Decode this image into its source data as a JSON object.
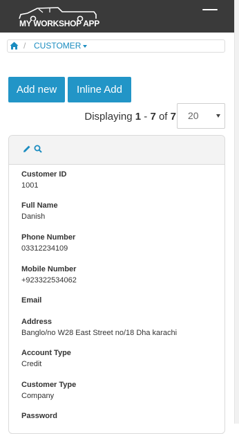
{
  "header": {
    "app_name": "MY WORKSHOP APP",
    "logo_icon": "pickup-truck-icon",
    "menu_icon": "hamburger-menu-icon"
  },
  "breadcrumb": {
    "home_icon": "home-icon",
    "separator": "/",
    "current": "CUSTOMER"
  },
  "toolbar": {
    "add_new_label": "Add new",
    "inline_add_label": "Inline Add"
  },
  "pagination": {
    "prefix": "Displaying",
    "from": "1",
    "dash": "-",
    "to": "7",
    "of": "of",
    "total": "7",
    "page_size": "20"
  },
  "record": {
    "fields": [
      {
        "label": "Customer ID",
        "value": "1001"
      },
      {
        "label": "Full Name",
        "value": "Danish"
      },
      {
        "label": "Phone Number",
        "value": "03312234109"
      },
      {
        "label": "Mobile Number",
        "value": "+923322534062"
      },
      {
        "label": "Email",
        "value": ""
      },
      {
        "label": "Address",
        "value": "Banglo/no W28 East Street no/18 Dha karachi"
      },
      {
        "label": "Account Type",
        "value": "Credit"
      },
      {
        "label": "Customer Type",
        "value": "Company"
      },
      {
        "label": "Password",
        "value": ""
      }
    ]
  },
  "colors": {
    "topbar": "#3a3a3a",
    "accent": "#2295c7",
    "link": "#1a8cc0"
  }
}
